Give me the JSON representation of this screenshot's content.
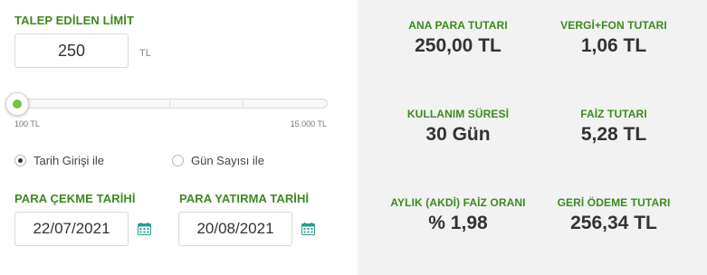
{
  "limit": {
    "label": "TALEP EDİLEN LİMİT",
    "value": "250",
    "unit": "TL",
    "slider": {
      "min_label": "100 TL",
      "max_label": "15.000 TL",
      "min": 100,
      "max": 15000,
      "value": 250
    }
  },
  "mode": {
    "options": [
      {
        "label": "Tarih Girişi ile",
        "checked": true
      },
      {
        "label": "Gün Sayısı ile",
        "checked": false
      }
    ]
  },
  "dates": {
    "withdraw": {
      "label": "PARA ÇEKME TARİHİ",
      "value": "22/07/2021"
    },
    "deposit": {
      "label": "PARA YATIRMA TARİHİ",
      "value": "20/08/2021"
    }
  },
  "results": {
    "principal": {
      "label": "ANA PARA TUTARI",
      "value": "250,00 TL"
    },
    "tax": {
      "label": "VERGİ+FON TUTARI",
      "value": "1,06 TL"
    },
    "duration": {
      "label": "KULLANIM SÜRESİ",
      "value": "30 Gün"
    },
    "interest": {
      "label": "FAİZ TUTARI",
      "value": "5,28 TL"
    },
    "monthly_rate": {
      "label": "AYLIK (AKDİ) FAİZ ORANI",
      "value": "% 1,98"
    },
    "repayment": {
      "label": "GERİ ÖDEME TUTARI",
      "value": "256,34 TL"
    }
  },
  "colors": {
    "accent_green": "#3d8a1f",
    "slider_green": "#7bc142",
    "calendar_teal": "#2a9d8f",
    "panel_bg": "#f2f2f2"
  },
  "icons": {
    "calendar": "calendar-icon"
  }
}
